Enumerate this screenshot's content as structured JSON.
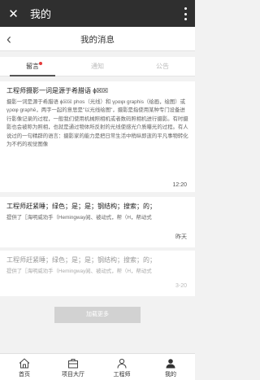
{
  "status_bar": {
    "close_glyph": "✕",
    "title": "我的"
  },
  "nav": {
    "back_glyph": "‹",
    "title": "我的消息"
  },
  "tabs": [
    {
      "label": "留言",
      "active": true,
      "has_dot": true
    },
    {
      "label": "通知",
      "active": false,
      "has_dot": false
    },
    {
      "label": "公告",
      "active": false,
      "has_dot": false
    }
  ],
  "messages": [
    {
      "title": "工程师摄影一词是源于希腊语 ϕ☒☒",
      "body": "摄影一词是源于希腊语 ϕ☒☒ phos（光线）和 γραφι graphis（绘画，绘图）或γραφ graphē，两字一起的意思是\"以光线绘图\"，摄影是指使用某种专门设备进行影像记录的过程，一般我们使用机械照相机或者数码照相机进行摄影。有时摄影也会被称为照相，也就是通过物体所反射的光线使感光介质曝光的过程。有人说过的一句精辟的语言：摄影家的能力是把日常生活中稍纵即逝的平凡事物转化为不朽的视觉图像",
      "time": "12:20",
      "read": false
    },
    {
      "title": "工程师赶紧睡；绿色；是；是；钢结构；搜索；的；",
      "body": "提供了［海明威劝手（Hemingway阅、被动式，帮（H，帮动式",
      "time": "昨天",
      "read": false
    },
    {
      "title": "工程师赶紧睡；绿色；是；是；钢结构；搜索；的；",
      "body": "提供了［海明威劝手（Hemingway阅、被动式，帮（H，帮动式",
      "time": "3-20",
      "read": true
    }
  ],
  "load_more_label": "加载更多",
  "bottom_tabs": [
    {
      "label": "首页",
      "icon": "home-icon"
    },
    {
      "label": "项目大厅",
      "icon": "project-hall-icon"
    },
    {
      "label": "工程师",
      "icon": "engineer-icon"
    },
    {
      "label": "我的",
      "icon": "user-icon"
    }
  ],
  "colors": {
    "accent_dark": "#2f2f2f",
    "badge_red": "#e53a3a",
    "load_more_bg": "#d2d2d2"
  }
}
